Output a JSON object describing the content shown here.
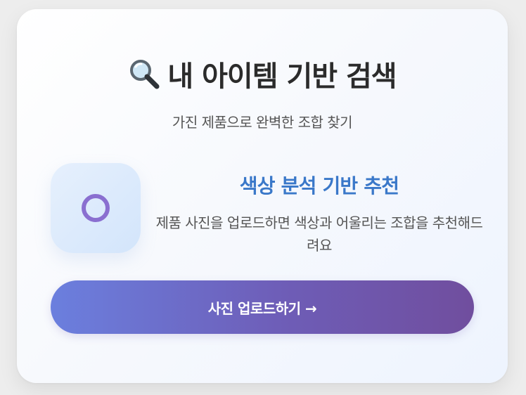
{
  "header": {
    "title": "내 아이템 기반 검색",
    "subtitle": "가진 제품으로 완벽한 조합 찾기",
    "title_icon": "magnifying-glass-icon"
  },
  "feature": {
    "icon": "ring-icon",
    "title": "색상 분석 기반 추천",
    "description": "제품 사진을 업로드하면 색상과 어울리는 조합을 추천해드려요"
  },
  "actions": {
    "upload_label": "사진 업로드하기 →"
  },
  "colors": {
    "accent_blue": "#3a78c9",
    "ring_purple": "#8a6fd0",
    "button_start": "#6b7fde",
    "button_end": "#704e9e"
  }
}
